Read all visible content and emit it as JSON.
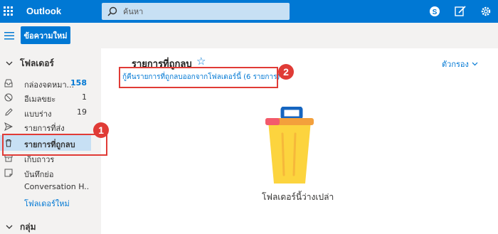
{
  "app": {
    "title": "Outlook"
  },
  "search": {
    "placeholder": "ค้นหา"
  },
  "header_icons": [
    "skype-icon",
    "compose-note-icon",
    "settings-gear-icon"
  ],
  "toolbar": {
    "new_message_label": "ข้อความใหม่"
  },
  "sidebar": {
    "folders_header": "โฟลเดอร์",
    "items": [
      {
        "label": "กล่องจดหมา...",
        "count": "158",
        "icon": "inbox-icon"
      },
      {
        "label": "อีเมลขยะ",
        "count": "1",
        "icon": "junk-icon"
      },
      {
        "label": "แบบร่าง",
        "count": "19",
        "icon": "pencil-icon"
      },
      {
        "label": "รายการที่ส่ง",
        "count": "",
        "icon": "send-icon"
      },
      {
        "label": "รายการที่ถูกลบ",
        "count": "",
        "icon": "trash-icon"
      },
      {
        "label": "เก็บถาวร",
        "count": "",
        "icon": "archive-icon"
      },
      {
        "label": "บันทึกย่อ",
        "count": "",
        "icon": "notes-icon"
      },
      {
        "label": "Conversation H...",
        "count": "",
        "icon": ""
      }
    ],
    "new_folder_label": "โฟลเดอร์ใหม่",
    "groups_header": "กลุ่ม"
  },
  "main": {
    "title": "รายการที่ถูกลบ",
    "recover_link": "กู้คืนรายการที่ถูกลบออกจากโฟลเดอร์นี้ (6 รายการ)",
    "filter_label": "ตัวกรอง",
    "empty_text": "โฟลเดอร์นี้ว่างเปล่า"
  },
  "annotations": {
    "badge1": "1",
    "badge2": "2"
  },
  "colors": {
    "brand": "#0078d4",
    "selected": "#c7e0f4",
    "highlight": "#e03b36"
  }
}
